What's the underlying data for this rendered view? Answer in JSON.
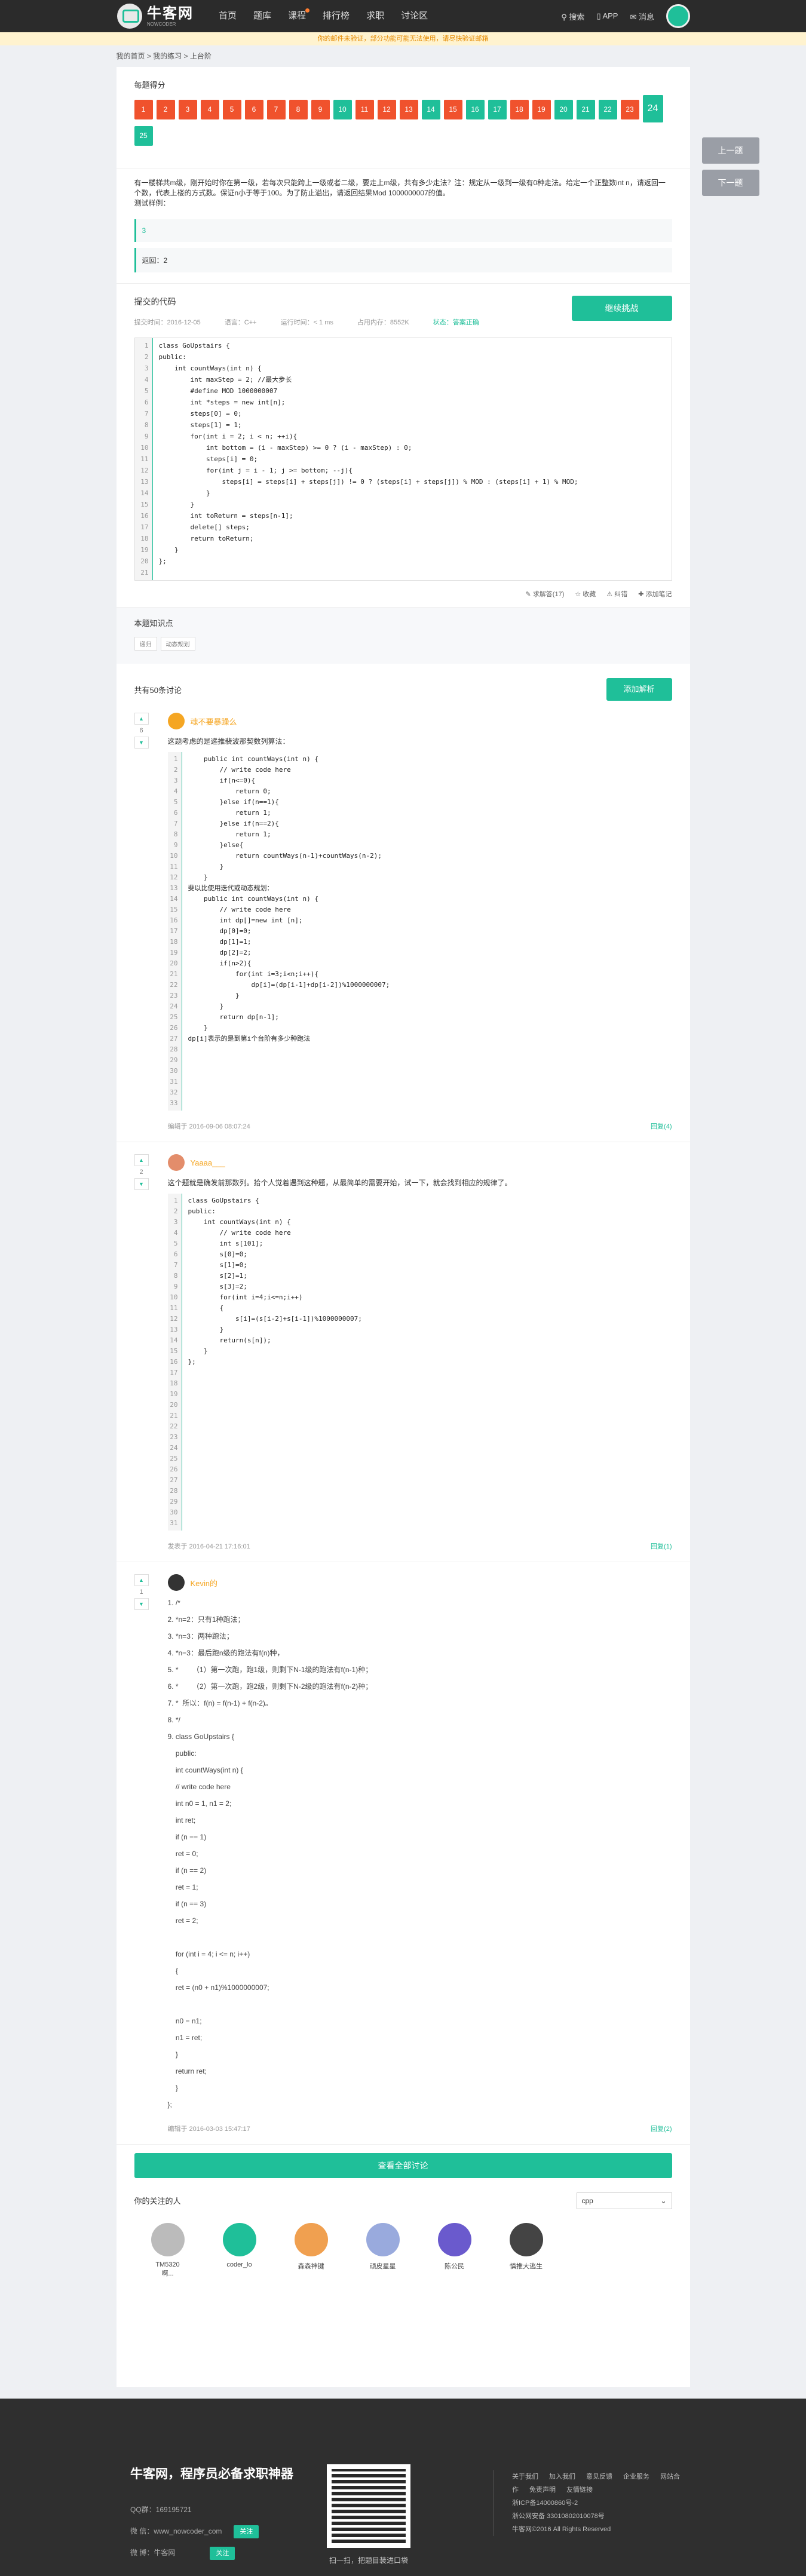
{
  "header": {
    "logo": "牛客网",
    "logo_sub": "NOWCODER",
    "nav": [
      "首页",
      "题库",
      "课程",
      "排行榜",
      "求职",
      "讨论区"
    ],
    "search": "搜索",
    "app": "APP",
    "msg": "消息"
  },
  "notice": "你的邮件未验证，部分功能可能无法使用，请尽快验证邮箱",
  "breadcrumb": "我的首页 > 我的练习 > 上台阶",
  "score": {
    "label": "每题得分",
    "items": [
      {
        "n": "1",
        "s": "w"
      },
      {
        "n": "2",
        "s": "w"
      },
      {
        "n": "3",
        "s": "w"
      },
      {
        "n": "4",
        "s": "w"
      },
      {
        "n": "5",
        "s": "w"
      },
      {
        "n": "6",
        "s": "w"
      },
      {
        "n": "7",
        "s": "w"
      },
      {
        "n": "8",
        "s": "w"
      },
      {
        "n": "9",
        "s": "w"
      },
      {
        "n": "10",
        "s": "r"
      },
      {
        "n": "11",
        "s": "w"
      },
      {
        "n": "12",
        "s": "w"
      },
      {
        "n": "13",
        "s": "w"
      },
      {
        "n": "14",
        "s": "r"
      },
      {
        "n": "15",
        "s": "w"
      },
      {
        "n": "16",
        "s": "r"
      },
      {
        "n": "17",
        "s": "r"
      },
      {
        "n": "18",
        "s": "w"
      },
      {
        "n": "19",
        "s": "w"
      },
      {
        "n": "20",
        "s": "r"
      },
      {
        "n": "21",
        "s": "r"
      },
      {
        "n": "22",
        "s": "r"
      },
      {
        "n": "23",
        "s": "w"
      },
      {
        "n": "24",
        "s": "r",
        "cur": true
      },
      {
        "n": "25",
        "s": "r"
      }
    ]
  },
  "side": {
    "prev": "上一题",
    "next": "下一题"
  },
  "question": {
    "text": "有一楼梯共m级，刚开始时你在第一级，若每次只能跨上一级或者二级，要走上m级，共有多少走法？注：规定从一级到一级有0种走法。给定一个正整数int n，请返回一个数，代表上楼的方式数。保证n小于等于100。为了防止溢出，请返回结果Mod 1000000007的值。",
    "example_label": "测试样例：",
    "example_in": "3",
    "example_out": "返回：2"
  },
  "submission": {
    "title": "提交的代码",
    "continue": "继续挑战",
    "time": "提交时间：2016-12-05",
    "lang": "语言：C++",
    "runtime": "运行时间：< 1 ms",
    "mem": "占用内存：8552K",
    "status": "状态：答案正确"
  },
  "code_lines": [
    "class GoUpstairs {",
    "public:",
    "    int countWays(int n) {",
    "        int maxStep = 2; //最大步长",
    "        #define MOD 1000000007",
    "        int *steps = new int[n];",
    "        steps[0] = 0;",
    "        steps[1] = 1;",
    "        for(int i = 2; i < n; ++i){",
    "            int bottom = (i - maxStep) >= 0 ? (i - maxStep) : 0;",
    "            steps[i] = 0;",
    "            for(int j = i - 1; j >= bottom; --j){",
    "                steps[i] = steps[i] + steps[j]) != 0 ? (steps[i] + steps[j]) % MOD : (steps[i] + 1) % MOD;",
    "            }",
    "",
    "        }",
    "        int toReturn = steps[n-1];",
    "        delete[] steps;",
    "        return toReturn;",
    "    }",
    "};"
  ],
  "actions": [
    "求解答(17)",
    "收藏",
    "纠错",
    "添加笔记"
  ],
  "knowledge": {
    "title": "本题知识点",
    "tags": [
      "递归",
      "动态规划"
    ]
  },
  "discuss": {
    "title": "共有50条讨论",
    "add": "添加解析",
    "view_all": "查看全部讨论"
  },
  "posts": [
    {
      "user": "魂不要暴躁么",
      "votes": "6",
      "intro": "这题考虑的是递推裴波那契数列算法：",
      "code": [
        "    public int countWays(int n) {",
        "        // write code here",
        "",
        "        if(n<=0){",
        "            return 0;",
        "        }else if(n==1){",
        "            return 1;",
        "        }else if(n==2){",
        "            return 1;",
        "        }else{",
        "            return countWays(n-1)+countWays(n-2);",
        "        }",
        "",
        "    }",
        "",
        "斐以比使用迭代或动态规划：",
        "    public int countWays(int n) {",
        "        // write code here",
        "",
        "        int dp[]=new int [n];",
        "",
        "        dp[0]=0;",
        "        dp[1]=1;",
        "        dp[2]=2;",
        "        if(n>2){",
        "            for(int i=3;i<n;i++){",
        "                dp[i]=(dp[i-1]+dp[i-2])%1000000007;",
        "            }",
        "        }",
        "        return dp[n-1];",
        "",
        "    }",
        "dp[i]表示的是到第i个台阶有多少种跑法"
      ],
      "time": "编辑于 2016-09-06 08:07:24",
      "reply": "回复(4)"
    },
    {
      "user": "Yaaaa___",
      "votes": "2",
      "intro": "这个题就是确发前那数列。拾个人觉着遇到这种题，从最简单的需要开始，试一下，就会找到相应的规律了。",
      "code": [
        "class GoUpstairs {",
        "",
        "public:",
        "",
        "    int countWays(int n) {",
        "",
        "        // write code here",
        "",
        "        int s[101];",
        "",
        "        s[0]=0;",
        "",
        "        s[1]=0;",
        "",
        "        s[2]=1;",
        "",
        "        s[3]=2;",
        "",
        "        for(int i=4;i<=n;i++)",
        "",
        "        {",
        "",
        "            s[i]=(s[i-2]+s[i-1])%1000000007;",
        "",
        "        }",
        "",
        "        return(s[n]);",
        "",
        "    }",
        "",
        "};"
      ],
      "time": "发表于 2016-04-21 17:16:01",
      "reply": "回复(1)"
    },
    {
      "user": "Kevin的",
      "votes": "1",
      "lines": [
        "1. /*",
        "2. *n=2：只有1种跑法；",
        "3. *n=3：两种跑法；",
        "4. *n=3：最后跑n级的跑法有f(n)种，",
        "5. *       （1）第一次跑，跑1级，则剩下N-1级的跑法有f(n-1)种；",
        "6. *       （2）第一次跑，跑2级，则剩下N-2级的跑法有f(n-2)种；",
        "7. *  所以：f(n) = f(n-1) + f(n-2)。",
        "8. */",
        "9. class GoUpstairs {",
        "    public:",
        "    int countWays(int n) {",
        "    // write code here",
        "    int n0 = 1, n1 = 2;",
        "    int ret;",
        "    if (n == 1)",
        "    ret = 0;",
        "    if (n == 2)",
        "    ret = 1;",
        "    if (n == 3)",
        "    ret = 2;",
        "",
        "    for (int i = 4; i <= n; i++)",
        "    {",
        "    ret = (n0 + n1)%1000000007;",
        "",
        "    n0 = n1;",
        "    n1 = ret;",
        "    }",
        "    return ret;",
        "    }",
        "};"
      ],
      "time": "编辑于 2016-03-03 15:47:17",
      "reply": "回复(2)"
    }
  ],
  "following": {
    "title": "你的关注的人",
    "lang": "cpp",
    "users": [
      "TM5320啊...",
      "coder_lo",
      "森森神键",
      "顽皮星星",
      "陈公民",
      "慎推大逃生"
    ]
  },
  "footer": {
    "slogan": "牛客网，程序员必备求职神器",
    "qq": "QQ群：169195721",
    "wechat": "微 信：www_nowcoder_com",
    "weibo": "微 博：牛客网",
    "follow": "关注",
    "qr_text": "扫一扫，把题目装进口袋",
    "links": [
      "关于我们",
      "加入我们",
      "意见反馈",
      "企业服务",
      "网站合作",
      "免责声明",
      "友情链接"
    ],
    "icp": "浙ICP备14000860号-2",
    "police": "浙公网安备 33010802010078号",
    "copy": "牛客网©2016 All Rights Reserved"
  }
}
